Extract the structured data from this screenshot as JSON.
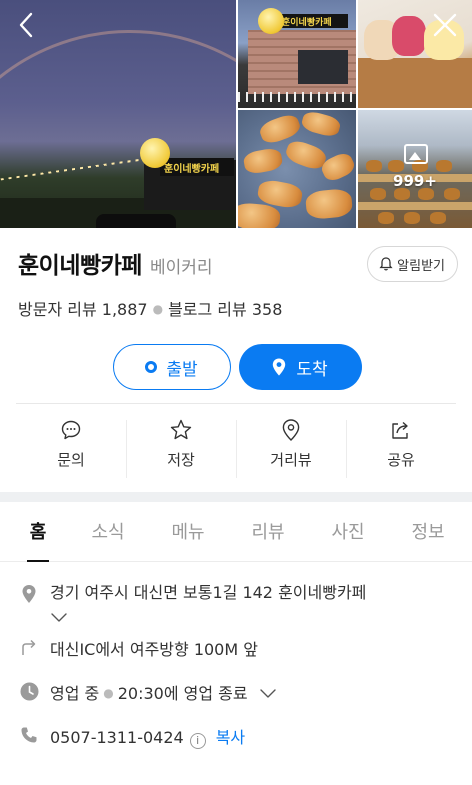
{
  "gallery": {
    "photo_count": "999+",
    "main_sign_text": "훈이네빵카페",
    "shop_sign_text": "훈이네빵카페"
  },
  "place": {
    "name": "훈이네빵카페",
    "category": "베이커리",
    "alarm_label": "알림받기",
    "visitor_reviews": "방문자 리뷰 1,887",
    "blog_reviews": "블로그 리뷰 358"
  },
  "route": {
    "depart_label": "출발",
    "arrive_label": "도착"
  },
  "actions": [
    {
      "label": "문의",
      "icon": "chat-bubble-icon"
    },
    {
      "label": "저장",
      "icon": "star-icon"
    },
    {
      "label": "거리뷰",
      "icon": "location-pin-icon"
    },
    {
      "label": "공유",
      "icon": "share-icon"
    }
  ],
  "tabs": [
    {
      "label": "홈",
      "active": true
    },
    {
      "label": "소식"
    },
    {
      "label": "메뉴"
    },
    {
      "label": "리뷰"
    },
    {
      "label": "사진"
    },
    {
      "label": "정보"
    }
  ],
  "details": {
    "address": "경기 여주시 대신면 보통1길 142 훈이네빵카페",
    "directions": "대신IC에서 여주방향 100M 앞",
    "status": "영업 중",
    "hours": "20:30에 영업 종료",
    "phone": "0507-1311-0424",
    "copy_label": "복사"
  },
  "colors": {
    "accent": "#0a7bf2",
    "text": "#222222",
    "muted": "#8a8a8a"
  }
}
